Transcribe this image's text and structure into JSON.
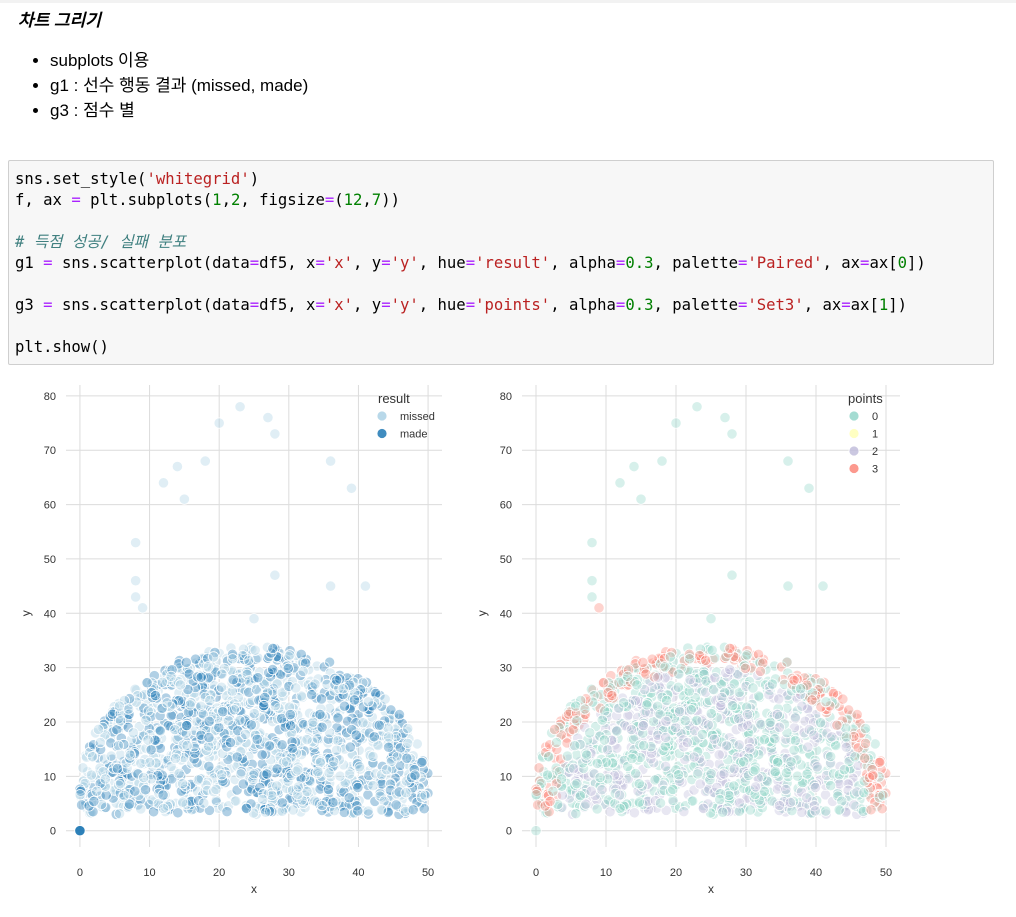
{
  "heading": "차트 그리기",
  "bullets": [
    "subplots 이용",
    "g1 : 선수 행동 결과 (missed, made)",
    "g3 : 점수 별"
  ],
  "code": {
    "lines": [
      [
        {
          "t": "sns.set_style("
        },
        {
          "t": "'whitegrid'",
          "c": "s"
        },
        {
          "t": ")"
        }
      ],
      [
        {
          "t": "f, ax "
        },
        {
          "t": "=",
          "c": "o"
        },
        {
          "t": " plt.subplots("
        },
        {
          "t": "1",
          "c": "n"
        },
        {
          "t": ","
        },
        {
          "t": "2",
          "c": "n"
        },
        {
          "t": ", figsize"
        },
        {
          "t": "=",
          "c": "o"
        },
        {
          "t": "("
        },
        {
          "t": "12",
          "c": "n"
        },
        {
          "t": ","
        },
        {
          "t": "7",
          "c": "n"
        },
        {
          "t": "))"
        }
      ],
      [],
      [
        {
          "t": "# 득점 성공/ 실패 분포",
          "c": "c"
        }
      ],
      [
        {
          "t": "g1 "
        },
        {
          "t": "=",
          "c": "o"
        },
        {
          "t": " sns.scatterplot(data"
        },
        {
          "t": "=",
          "c": "o"
        },
        {
          "t": "df5, x"
        },
        {
          "t": "=",
          "c": "o"
        },
        {
          "t": "'x'",
          "c": "s"
        },
        {
          "t": ", y"
        },
        {
          "t": "=",
          "c": "o"
        },
        {
          "t": "'y'",
          "c": "s"
        },
        {
          "t": ", hue"
        },
        {
          "t": "=",
          "c": "o"
        },
        {
          "t": "'result'",
          "c": "s"
        },
        {
          "t": ", alpha"
        },
        {
          "t": "=",
          "c": "o"
        },
        {
          "t": "0.3",
          "c": "n"
        },
        {
          "t": ", palette"
        },
        {
          "t": "=",
          "c": "o"
        },
        {
          "t": "'Paired'",
          "c": "s"
        },
        {
          "t": ", ax"
        },
        {
          "t": "=",
          "c": "o"
        },
        {
          "t": "ax["
        },
        {
          "t": "0",
          "c": "n"
        },
        {
          "t": "])"
        }
      ],
      [],
      [
        {
          "t": "g3 "
        },
        {
          "t": "=",
          "c": "o"
        },
        {
          "t": " sns.scatterplot(data"
        },
        {
          "t": "=",
          "c": "o"
        },
        {
          "t": "df5, x"
        },
        {
          "t": "=",
          "c": "o"
        },
        {
          "t": "'x'",
          "c": "s"
        },
        {
          "t": ", y"
        },
        {
          "t": "=",
          "c": "o"
        },
        {
          "t": "'y'",
          "c": "s"
        },
        {
          "t": ", hue"
        },
        {
          "t": "=",
          "c": "o"
        },
        {
          "t": "'points'",
          "c": "s"
        },
        {
          "t": ", alpha"
        },
        {
          "t": "=",
          "c": "o"
        },
        {
          "t": "0.3",
          "c": "n"
        },
        {
          "t": ", palette"
        },
        {
          "t": "=",
          "c": "o"
        },
        {
          "t": "'Set3'",
          "c": "s"
        },
        {
          "t": ", ax"
        },
        {
          "t": "=",
          "c": "o"
        },
        {
          "t": "ax["
        },
        {
          "t": "1",
          "c": "n"
        },
        {
          "t": "])"
        }
      ],
      [],
      [
        {
          "t": "plt.show()"
        }
      ]
    ]
  },
  "chart_data": [
    {
      "type": "scatter",
      "xlabel": "x",
      "ylabel": "y",
      "xlim": [
        -2,
        52
      ],
      "ylim": [
        -3,
        82
      ],
      "xticks": [
        0,
        10,
        20,
        30,
        40,
        50
      ],
      "yticks": [
        0,
        10,
        20,
        30,
        40,
        50,
        60,
        70,
        80
      ],
      "grid": true,
      "legend": {
        "title": "result",
        "placement": "top-right",
        "entries": [
          "missed",
          "made"
        ]
      },
      "colors": {
        "missed": "#a6cee3",
        "made": "#1f78b4"
      },
      "point_alpha": 0.3,
      "outliers": [
        {
          "x": 23,
          "y": 78
        },
        {
          "x": 27,
          "y": 76
        },
        {
          "x": 28,
          "y": 73
        },
        {
          "x": 20,
          "y": 75
        },
        {
          "x": 14,
          "y": 67
        },
        {
          "x": 18,
          "y": 68
        },
        {
          "x": 12,
          "y": 64
        },
        {
          "x": 15,
          "y": 61
        },
        {
          "x": 36,
          "y": 68
        },
        {
          "x": 39,
          "y": 63
        },
        {
          "x": 8,
          "y": 53
        },
        {
          "x": 8,
          "y": 46
        },
        {
          "x": 8,
          "y": 43
        },
        {
          "x": 9,
          "y": 41
        },
        {
          "x": 28,
          "y": 47
        },
        {
          "x": 36,
          "y": 45
        },
        {
          "x": 41,
          "y": 45
        },
        {
          "x": 25,
          "y": 39
        },
        {
          "x": 0,
          "y": 0
        }
      ],
      "bulk": {
        "shape": "half-disc",
        "x_range": [
          0,
          50
        ],
        "y_range": [
          3,
          36
        ],
        "center_x": 25,
        "radius_x": 24,
        "radius_y": 30
      }
    },
    {
      "type": "scatter",
      "xlabel": "x",
      "ylabel": "y",
      "xlim": [
        -2,
        52
      ],
      "ylim": [
        -3,
        82
      ],
      "xticks": [
        0,
        10,
        20,
        30,
        40,
        50
      ],
      "yticks": [
        0,
        10,
        20,
        30,
        40,
        50,
        60,
        70,
        80
      ],
      "grid": true,
      "legend": {
        "title": "points",
        "placement": "top-right",
        "entries": [
          "0",
          "1",
          "2",
          "3"
        ]
      },
      "colors": {
        "0": "#8dd3c7",
        "1": "#ffffb3",
        "2": "#bebada",
        "3": "#fb8072"
      },
      "point_alpha": 0.3,
      "outliers": [
        {
          "x": 23,
          "y": 78
        },
        {
          "x": 27,
          "y": 76
        },
        {
          "x": 28,
          "y": 73
        },
        {
          "x": 20,
          "y": 75
        },
        {
          "x": 14,
          "y": 67
        },
        {
          "x": 18,
          "y": 68
        },
        {
          "x": 12,
          "y": 64
        },
        {
          "x": 15,
          "y": 61
        },
        {
          "x": 36,
          "y": 68
        },
        {
          "x": 39,
          "y": 63
        },
        {
          "x": 8,
          "y": 53
        },
        {
          "x": 8,
          "y": 46
        },
        {
          "x": 8,
          "y": 43
        },
        {
          "x": 9,
          "y": 41
        },
        {
          "x": 28,
          "y": 47
        },
        {
          "x": 36,
          "y": 45
        },
        {
          "x": 41,
          "y": 45
        },
        {
          "x": 25,
          "y": 39
        },
        {
          "x": 0,
          "y": 0
        }
      ],
      "bulk": {
        "shape": "half-disc",
        "x_range": [
          0,
          50
        ],
        "y_range": [
          3,
          36
        ],
        "three_point_arc": true
      }
    }
  ]
}
